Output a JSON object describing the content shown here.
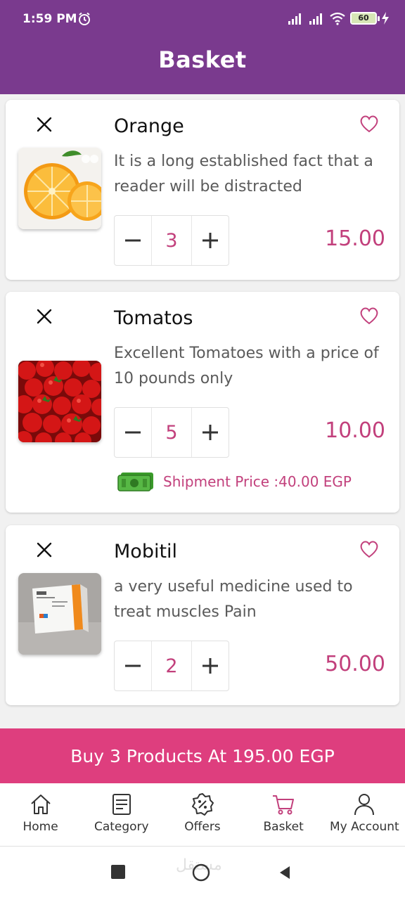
{
  "status_bar": {
    "time": "1:59 PM",
    "battery": "60"
  },
  "header": {
    "title": "Basket"
  },
  "items": [
    {
      "name": "Orange",
      "description": "It is a long established fact that a reader will be distracted",
      "quantity": "3",
      "price": "15.00"
    },
    {
      "name": "Tomatos",
      "description": "Excellent Tomatoes with a price of 10 pounds only",
      "quantity": "5",
      "price": "10.00",
      "shipment": "Shipment Price :40.00 EGP"
    },
    {
      "name": "Mobitil",
      "description": "a very useful medicine used to treat muscles Pain",
      "quantity": "2",
      "price": "50.00"
    }
  ],
  "buy_button": "Buy 3 Products At 195.00 EGP",
  "nav": [
    {
      "label": "Home",
      "icon": "home-icon"
    },
    {
      "label": "Category",
      "icon": "category-icon"
    },
    {
      "label": "Offers",
      "icon": "offers-icon"
    },
    {
      "label": "Basket",
      "icon": "basket-icon"
    },
    {
      "label": "My Account",
      "icon": "account-icon"
    }
  ],
  "watermark": "مستقل",
  "colors": {
    "primary": "#7a3a8e",
    "accent": "#c2407c",
    "buy_bar": "#de3e7e"
  }
}
